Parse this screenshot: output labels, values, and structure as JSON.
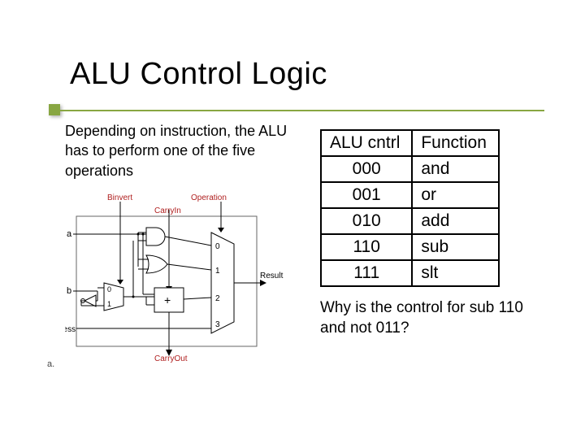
{
  "title": "ALU Control Logic",
  "intro": "Depending on instruction, the ALU has to perform one of the five operations",
  "table": {
    "headers": [
      "ALU cntrl",
      "Function"
    ],
    "rows": [
      {
        "code": "000",
        "fn": "and"
      },
      {
        "code": "001",
        "fn": "or"
      },
      {
        "code": "010",
        "fn": "add"
      },
      {
        "code": "110",
        "fn": "sub"
      },
      {
        "code": "111",
        "fn": "slt"
      }
    ]
  },
  "question": "Why is the control for sub 110 and not 011?",
  "diagram": {
    "top_labels": {
      "binvert": "Binvert",
      "operation": "Operation",
      "carryin": "CarryIn"
    },
    "inputs": {
      "a": "a",
      "b": "b",
      "less": "Less"
    },
    "mux_small": [
      "0",
      "1"
    ],
    "mux_large": [
      "0",
      "1",
      "2",
      "3"
    ],
    "adder": "+",
    "outputs": {
      "result": "Result",
      "carryout": "CarryOut"
    },
    "sublabel": "a."
  }
}
